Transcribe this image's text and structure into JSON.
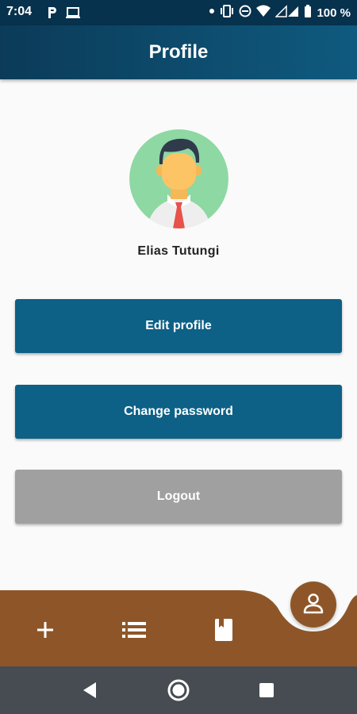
{
  "status_bar": {
    "time": "7:04",
    "battery": "100 %",
    "icons": [
      "parking-icon",
      "laptop-icon",
      "dot-icon",
      "vibrate-icon",
      "do-not-disturb-icon",
      "wifi-icon",
      "signal-icon",
      "battery-icon"
    ]
  },
  "header": {
    "title": "Profile"
  },
  "profile": {
    "name": "Elias Tutungi",
    "avatar_icon": "user-avatar"
  },
  "actions": {
    "edit_label": "Edit profile",
    "password_label": "Change password",
    "logout_label": "Logout"
  },
  "bottom_nav": {
    "items": [
      "add-icon",
      "list-icon",
      "bookmark-book-icon"
    ],
    "active": "profile-icon"
  },
  "system_nav": [
    "back-icon",
    "home-icon",
    "recents-icon"
  ],
  "colors": {
    "primary": "#0d6086",
    "header": "#0b3b58",
    "accent": "#8e5628",
    "logout": "#a0a0a0",
    "system_nav": "#464c52"
  }
}
